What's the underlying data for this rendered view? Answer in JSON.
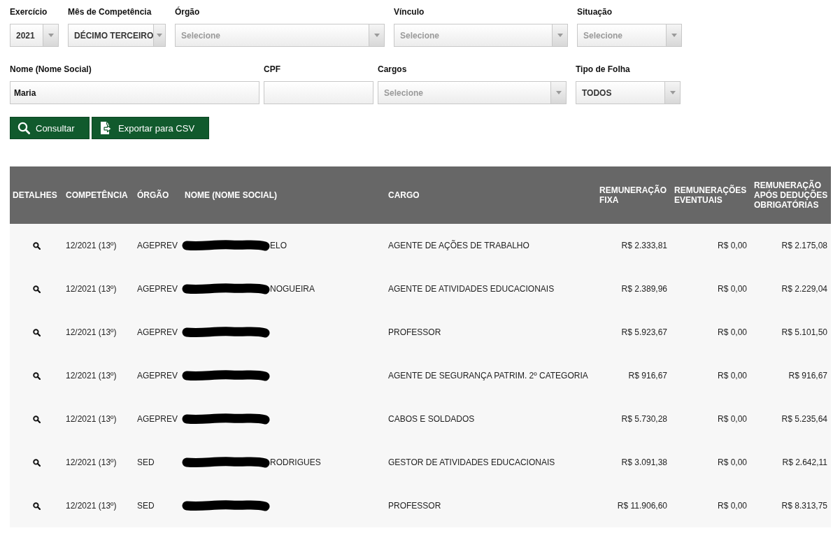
{
  "filter_rows": [
    [
      {
        "kind": "select",
        "label": "Exercício",
        "value": "2021"
      },
      {
        "kind": "select",
        "label": "Mês de Competência",
        "value": "DÉCIMO TERCEIRO"
      },
      {
        "kind": "select",
        "label": "Órgão",
        "placeholder": "Selecione"
      },
      {
        "kind": "select",
        "label": "Vínculo",
        "placeholder": "Selecione"
      },
      {
        "kind": "select",
        "label": "Situação",
        "placeholder": "Selecione"
      }
    ],
    [
      {
        "kind": "text",
        "label": "Nome (Nome Social)",
        "value": "Maria"
      },
      {
        "kind": "text",
        "label": "CPF"
      },
      {
        "kind": "select",
        "label": "Cargos",
        "placeholder": "Selecione"
      },
      {
        "kind": "select",
        "label": "Tipo de Folha",
        "value": "TODOS"
      }
    ]
  ],
  "buttons": [
    {
      "kind": "search",
      "label": "Consultar"
    },
    {
      "kind": "export",
      "label": "Exportar para CSV"
    }
  ],
  "table": {
    "columns": [
      "DETALHES",
      "COMPETÊNCIA",
      "ÓRGÃO",
      "NOME (NOME SOCIAL)",
      "CARGO",
      "REMUNERAÇÃO FIXA",
      "REMUNERAÇÕES EVENTUAIS",
      "REMUNERAÇÃO APÓS DEDUÇÕES OBRIGATÓRIAS"
    ],
    "rows": [
      {
        "competencia": "12/2021 (13º)",
        "orgao": "AGEPREV",
        "nome_redacted": true,
        "nome": "ELO",
        "cargo": "AGENTE DE AÇÕES DE TRABALHO",
        "remuneracao_fixa": "R$ 2.333,81",
        "remuneracoes_eventuais": "R$ 0,00",
        "remuneracao_apos_deducoes": "R$ 2.175,08"
      },
      {
        "competencia": "12/2021 (13º)",
        "orgao": "AGEPREV",
        "nome_redacted": true,
        "nome": "NOGUEIRA",
        "cargo": "AGENTE DE ATIVIDADES EDUCACIONAIS",
        "remuneracao_fixa": "R$ 2.389,96",
        "remuneracoes_eventuais": "R$ 0,00",
        "remuneracao_apos_deducoes": "R$ 2.229,04"
      },
      {
        "competencia": "12/2021 (13º)",
        "orgao": "AGEPREV",
        "nome_redacted": true,
        "cargo": "PROFESSOR",
        "remuneracao_fixa": "R$ 5.923,67",
        "remuneracoes_eventuais": "R$ 0,00",
        "remuneracao_apos_deducoes": "R$ 5.101,50"
      },
      {
        "competencia": "12/2021 (13º)",
        "orgao": "AGEPREV",
        "nome_redacted": true,
        "cargo": "AGENTE DE SEGURANÇA PATRIM. 2º CATEGORIA",
        "remuneracao_fixa": "R$ 916,67",
        "remuneracoes_eventuais": "R$ 0,00",
        "remuneracao_apos_deducoes": "R$ 916,67"
      },
      {
        "competencia": "12/2021 (13º)",
        "orgao": "AGEPREV",
        "nome_redacted": true,
        "cargo": "CABOS E SOLDADOS",
        "remuneracao_fixa": "R$ 5.730,28",
        "remuneracoes_eventuais": "R$ 0,00",
        "remuneracao_apos_deducoes": "R$ 5.235,64"
      },
      {
        "competencia": "12/2021 (13º)",
        "orgao": "SED",
        "nome_redacted": true,
        "nome": "RODRIGUES",
        "cargo": "GESTOR DE ATIVIDADES EDUCACIONAIS",
        "remuneracao_fixa": "R$ 3.091,38",
        "remuneracoes_eventuais": "R$ 0,00",
        "remuneracao_apos_deducoes": "R$ 2.642,11"
      },
      {
        "competencia": "12/2021 (13º)",
        "orgao": "SED",
        "nome_redacted": true,
        "cargo": "PROFESSOR",
        "remuneracao_fixa": "R$ 11.906,60",
        "remuneracoes_eventuais": "R$ 0,00",
        "remuneracao_apos_deducoes": "R$ 8.313,75"
      }
    ]
  }
}
